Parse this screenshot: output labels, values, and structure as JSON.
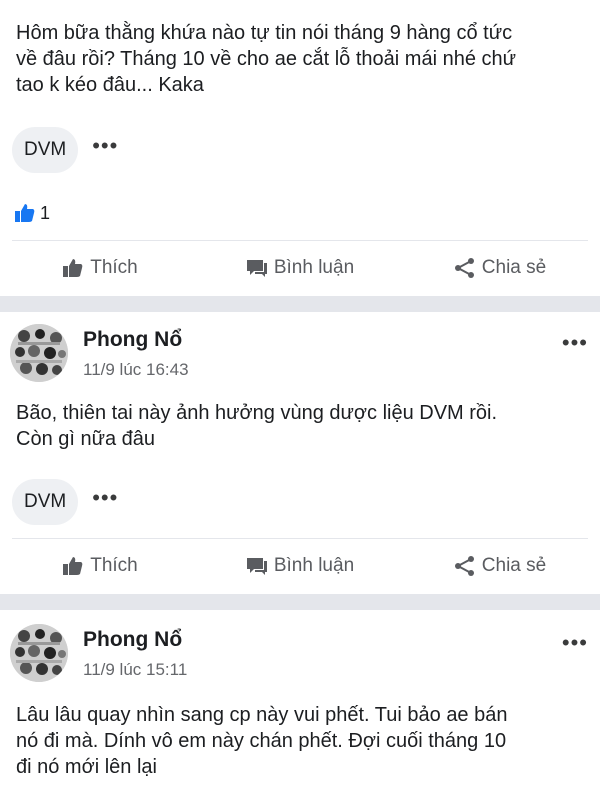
{
  "posts": [
    {
      "text_lines": [
        "Hôm bữa thằng khứa nào tự tin nói tháng 9 hàng cổ tức",
        "về đâu rồi? Tháng 10 về cho ae cắt lỗ thoải mái nhé chứ",
        "tao k kéo đâu... Kaka"
      ],
      "tag": "DVM",
      "more": "•••",
      "like_count": "1",
      "actions": {
        "like": "Thích",
        "comment": "Bình luận",
        "share": "Chia sẻ"
      }
    },
    {
      "author": "Phong Nổ",
      "time": "11/9 lúc 16:43",
      "menu": "•••",
      "text_lines": [
        "Bão, thiên tai này ảnh hưởng vùng dược liệu DVM rồi.",
        "Còn gì nữa đâu"
      ],
      "tag": "DVM",
      "more": "•••",
      "actions": {
        "like": "Thích",
        "comment": "Bình luận",
        "share": "Chia sẻ"
      }
    },
    {
      "author": "Phong Nổ",
      "time": "11/9 lúc 15:11",
      "menu": "•••",
      "text_lines": [
        "Lâu lâu quay nhìn sang cp này vui phết. Tui bảo ae bán",
        "nó đi mà. Dính vô em này chán phết. Đợi cuối tháng 10",
        "đi nó mới lên lại"
      ]
    }
  ],
  "colors": {
    "like_blue": "#1877f2",
    "separator": "#e4e6eb",
    "muted": "#65676b"
  },
  "icons": {
    "like": "thumbs-up-icon",
    "comment": "comment-icon",
    "share": "share-icon",
    "reaction": "like-reaction-icon"
  }
}
